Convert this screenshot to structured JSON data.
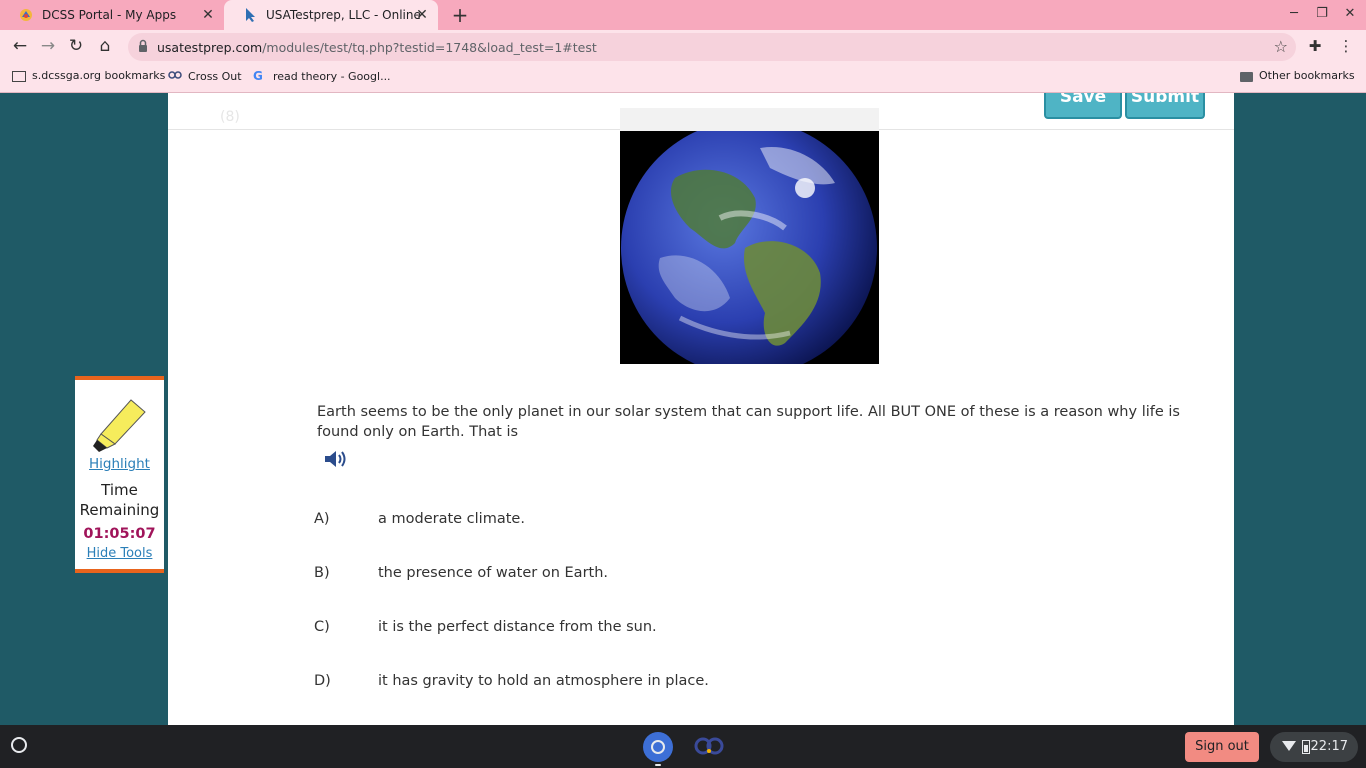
{
  "browser": {
    "tabs": [
      {
        "title": "DCSS Portal - My Apps",
        "active": false
      },
      {
        "title": "USATestprep, LLC - Online State-S",
        "active": true
      }
    ],
    "url_domain": "usatestprep.com",
    "url_path": "/modules/test/tq.php?testid=1748&load_test=1#test",
    "bookmarks": [
      "s.dcssga.org bookmarks",
      "Cross Out",
      "read theory - Googl..."
    ],
    "other_bookmarks": "Other bookmarks"
  },
  "test": {
    "question_number": "(8)",
    "save_label": "Save",
    "submit_label": "Submit",
    "question_text": "Earth seems to be the only planet in our solar system that can support life. All BUT ONE of these is a reason why life is found only on Earth. That is",
    "choices": [
      {
        "letter": "A)",
        "text": "a moderate climate."
      },
      {
        "letter": "B)",
        "text": "the presence of water on Earth."
      },
      {
        "letter": "C)",
        "text": "it is the perfect distance from the sun."
      },
      {
        "letter": "D)",
        "text": "it has gravity to hold an atmosphere in place."
      }
    ]
  },
  "tools": {
    "highlight_label": "Highlight",
    "time_remaining_label": [
      "Time",
      "Remaining"
    ],
    "time_remaining": "01:05:07",
    "hide_tools_label": "Hide Tools"
  },
  "shelf": {
    "sign_out_label": "Sign out",
    "clock": "22:17"
  },
  "colors": {
    "tabbar": "#f7a9bd",
    "page_background": "#1f5a66",
    "button": "#4fb4c5",
    "tools_border": "#e8641d",
    "timer": "#a0145a"
  }
}
